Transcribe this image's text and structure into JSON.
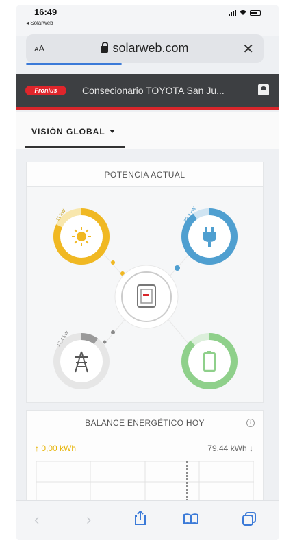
{
  "status": {
    "time": "16:49",
    "back_app": "◂ Solarweb"
  },
  "browser": {
    "aa": "ᴀA",
    "url": "solarweb.com",
    "close": "✕"
  },
  "brand": {
    "logo_text": "Fronius",
    "site_title": "Consecionario TOYOTA San Ju..."
  },
  "nav": {
    "view_label": "VISIÓN GLOBAL"
  },
  "power_card": {
    "title": "POTENCIA ACTUAL",
    "solar_value": "11 kW",
    "consumption_value": "28,3 kW",
    "grid_value": "17,4 kW",
    "solar_level": 0.82,
    "consumption_level": 0.9,
    "battery_level": 0.88,
    "grid_level": 0.1,
    "colors": {
      "solar": "#f0b823",
      "consumption": "#4f9fd0",
      "battery": "#8fd08b",
      "grid": "#9a9a9a"
    }
  },
  "balance_card": {
    "title": "BALANCE ENERGÉTICO HOY",
    "production_label": "↑ 0,00 kWh",
    "consumption_label": "79,44 kWh ↓"
  },
  "toolbar": {
    "back": "‹",
    "forward": "›"
  },
  "icons": [
    "lock-icon",
    "sun-icon",
    "plug-icon",
    "inverter-icon",
    "pylon-icon",
    "battery-icon",
    "info-icon",
    "share-icon",
    "bookmarks-icon",
    "tabs-icon"
  ]
}
